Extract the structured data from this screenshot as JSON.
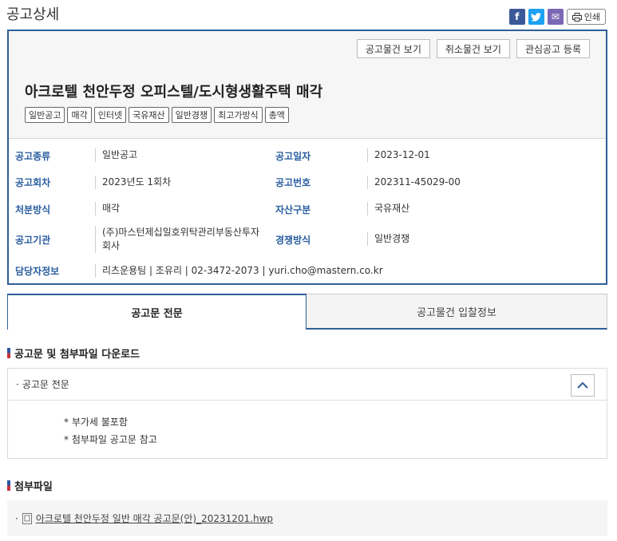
{
  "page": {
    "title": "공고상세"
  },
  "share": {
    "facebook": "f",
    "twitter": "t",
    "email": "✉",
    "print_label": "인쇄"
  },
  "buttons": {
    "view_items": "공고물건 보기",
    "view_cancelled": "취소물건 보기",
    "register_interest": "관심공고 등록"
  },
  "notice": {
    "title": "아크로텔 천안두정 오피스텔/도시형생활주택 매각",
    "tags": [
      "일반공고",
      "매각",
      "인터넷",
      "국유재산",
      "일반경쟁",
      "최고가방식",
      "총액"
    ]
  },
  "info": {
    "type_label": "공고종류",
    "type_value": "일반공고",
    "date_label": "공고일자",
    "date_value": "2023-12-01",
    "round_label": "공고회차",
    "round_value": "2023년도 1회차",
    "number_label": "공고번호",
    "number_value": "202311-45029-00",
    "disposal_label": "처분방식",
    "disposal_value": "매각",
    "asset_label": "자산구분",
    "asset_value": "국유재산",
    "agency_label": "공고기관",
    "agency_value_1": "(주)마스턴제십일호위탁관리부동산투자",
    "agency_value_2": "회사",
    "competition_label": "경쟁방식",
    "competition_value": "일반경쟁",
    "contact_label": "담당자정보",
    "contact_value": "리츠운용팀 | 조유리 | 02-3472-2073 | yuri.cho@mastern.co.kr"
  },
  "tabs": {
    "full_text": "공고문 전문",
    "bid_info": "공고물건 입찰정보"
  },
  "download": {
    "section_title": "공고문 및 첨부파일 다운로드",
    "accordion_title": "공고문 전문",
    "notes": [
      "* 부가세 불포함",
      "* 첨부파일 공고문 참고"
    ]
  },
  "attachments": {
    "section_title": "첨부파일",
    "file_name": "아크로텔 천안두정 일반 매각 공고문(안)_20231201.hwp"
  },
  "colors": {
    "accent": "#2f5f98",
    "label": "#2a5ea0"
  }
}
